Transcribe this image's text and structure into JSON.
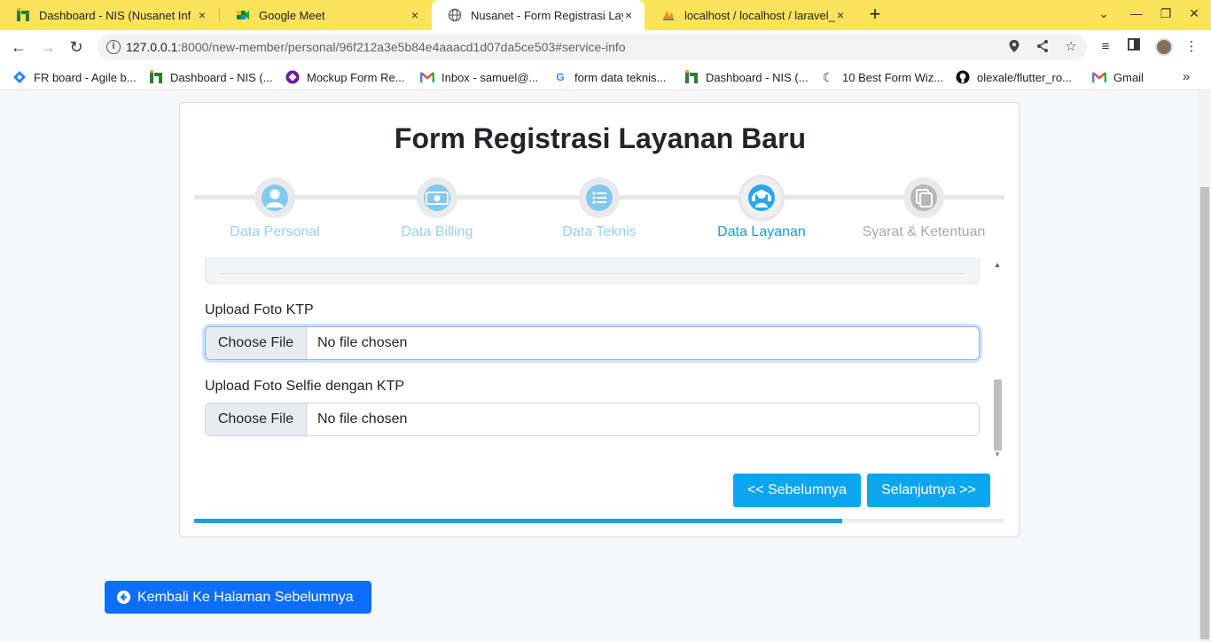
{
  "browser": {
    "tabs": [
      {
        "title": "Dashboard - NIS (Nusanet Inf",
        "favicon": "nis-icon",
        "active": false
      },
      {
        "title": "Google Meet",
        "favicon": "meet-icon",
        "active": false
      },
      {
        "title": "Nusanet - Form Registrasi Lay",
        "favicon": "globe-icon",
        "active": true
      },
      {
        "title": "localhost / localhost / laravel_",
        "favicon": "phpmyadmin-icon",
        "active": false
      }
    ],
    "tab_close": "×",
    "new_tab": "+",
    "url_host": "127.0.0.1",
    "url_rest": ":8000/new-member/personal/96f212a3e5b84e4aaacd1d07da5ce503#service-info",
    "bookmarks": [
      {
        "label": "FR board - Agile b...",
        "icon": "jira-icon"
      },
      {
        "label": "Dashboard - NIS (...",
        "icon": "nis-icon"
      },
      {
        "label": "Mockup Form Re...",
        "icon": "mockup-icon"
      },
      {
        "label": "Inbox - samuel@...",
        "icon": "gmail-icon"
      },
      {
        "label": "form data teknis...",
        "icon": "google-icon"
      },
      {
        "label": "Dashboard - NIS (...",
        "icon": "nis-icon"
      },
      {
        "label": "10 Best Form Wiz...",
        "icon": "moon-icon"
      },
      {
        "label": "olexale/flutter_ro...",
        "icon": "github-icon"
      },
      {
        "label": "Gmail",
        "icon": "gmail-icon"
      }
    ],
    "bookmarks_more": "»"
  },
  "form": {
    "title": "Form Registrasi Layanan Baru",
    "steps": [
      {
        "label": "Data Personal",
        "state": "done",
        "icon": "user-icon"
      },
      {
        "label": "Data Billing",
        "state": "done",
        "icon": "money-icon"
      },
      {
        "label": "Data Teknis",
        "state": "done",
        "icon": "list-icon"
      },
      {
        "label": "Data Layanan",
        "state": "active",
        "icon": "service-icon"
      },
      {
        "label": "Syarat & Ketentuan",
        "state": "pending",
        "icon": "document-icon"
      }
    ],
    "ktp": {
      "label": "Upload Foto KTP",
      "button": "Choose File",
      "value": "No file chosen"
    },
    "selfie": {
      "label": "Upload Foto Selfie dengan KTP",
      "button": "Choose File",
      "value": "No file chosen"
    },
    "prev_button": "<< Sebelumnya",
    "next_button": "Selanjutnya >>",
    "progress_percent": 80
  },
  "back_button": "Kembali Ke Halaman Sebelumnya",
  "colors": {
    "tab_strip": "#fbe45b",
    "accent": "#0ba5f0",
    "primary": "#0d6efd",
    "step_active": "#2ba7ec",
    "step_done": "#82c9f0"
  }
}
